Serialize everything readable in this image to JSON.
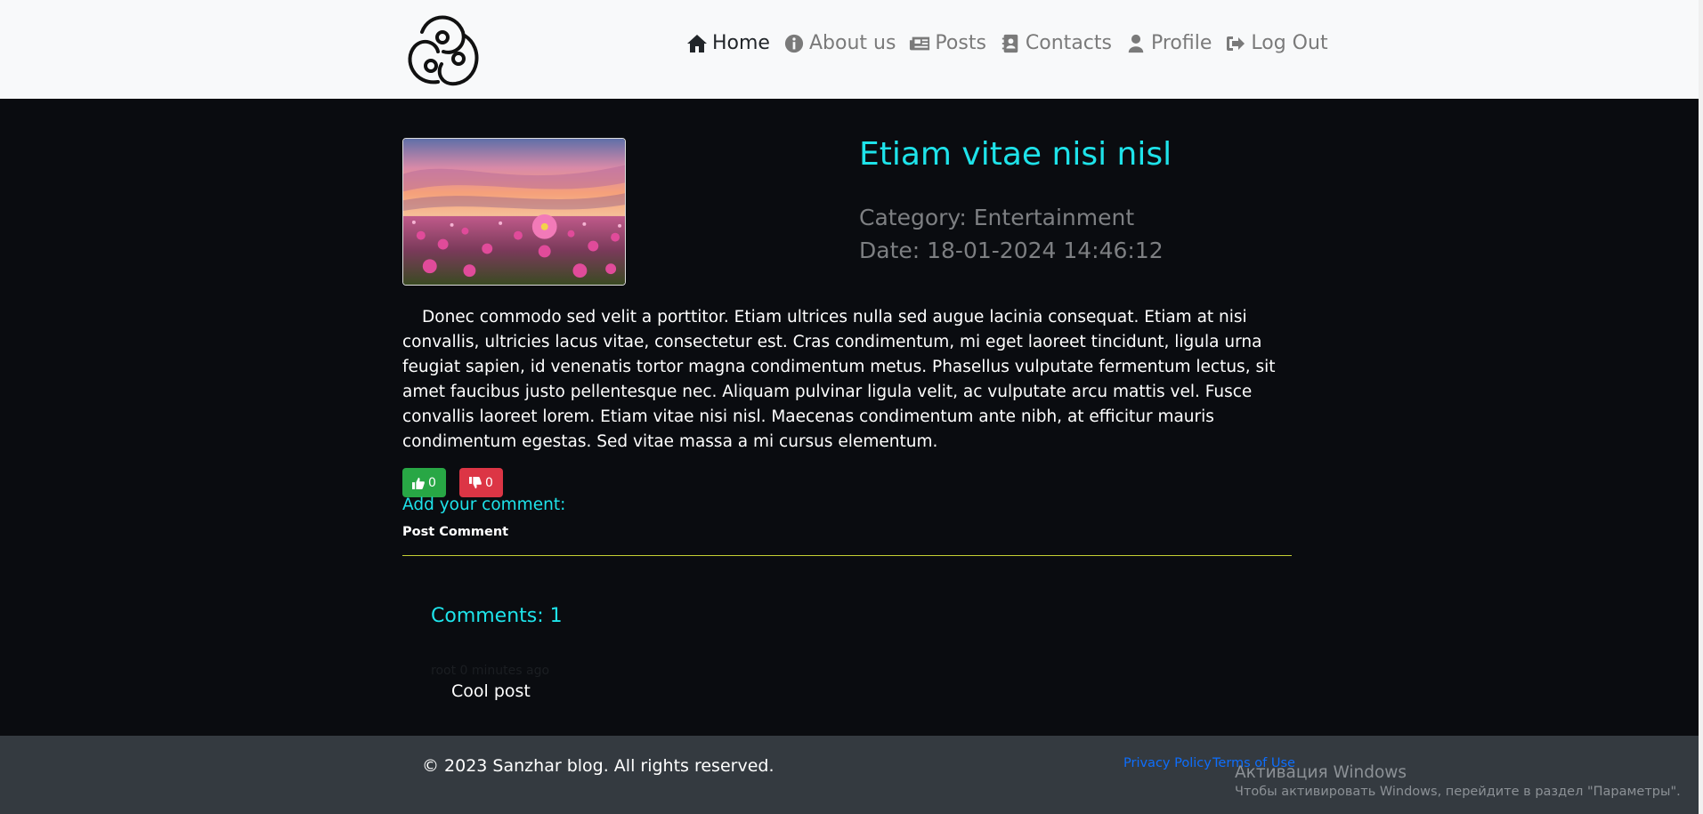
{
  "header": {
    "nav": [
      {
        "label": "Home",
        "icon": "home-icon",
        "active": true
      },
      {
        "label": "About us",
        "icon": "info-circle-icon",
        "active": false
      },
      {
        "label": "Posts",
        "icon": "newspaper-icon",
        "active": false
      },
      {
        "label": "Contacts",
        "icon": "address-book-icon",
        "active": false
      },
      {
        "label": "Profile",
        "icon": "user-icon",
        "active": false
      },
      {
        "label": "Log Out",
        "icon": "sign-out-icon",
        "active": false
      }
    ]
  },
  "post": {
    "title": "Etiam vitae nisi nisl",
    "category": "Category: Entertainment",
    "date": "Date: 18-01-2024 14:46:12",
    "body": "Donec commodo sed velit a porttitor. Etiam ultrices nulla sed augue lacinia consequat. Etiam at nisi convallis, ultricies lacus vitae, consectetur est. Cras condimentum, mi eget laoreet tincidunt, ligula urna feugiat sapien, id venenatis tortor magna condimentum metus. Phasellus vulputate fermentum lectus, sit amet faucibus justo pellentesque nec. Aliquam pulvinar ligula velit, ac vulputate arcu mattis vel. Fusce convallis laoreet lorem. Etiam vitae nisi nisl. Maecenas condimentum ante nibh, at efficitur mauris condimentum egestas. Sed vitae massa a mi cursus elementum.",
    "likes": "0",
    "dislikes": "0"
  },
  "comment_form": {
    "label": "Add your comment:",
    "submit_label": "Post Comment"
  },
  "comments": {
    "title": "Comments: 1",
    "items": [
      {
        "meta": "root 0 minutes ago",
        "text": "Cool post"
      }
    ]
  },
  "footer": {
    "copyright": "© 2023 Sanzhar blog. All rights reserved.",
    "privacy": "Privacy Policy",
    "terms": "Terms of Use"
  },
  "os_watermark": {
    "title": "Активация Windows",
    "subtitle": "Чтобы активировать Windows, перейдите в раздел \"Параметры\"."
  },
  "colors": {
    "accent": "#1ee3ea",
    "like": "#28a745",
    "dislike": "#dc3545",
    "divider": "#c5cf34",
    "footer_bg": "#343a40",
    "page_bg": "#0a0c10"
  }
}
